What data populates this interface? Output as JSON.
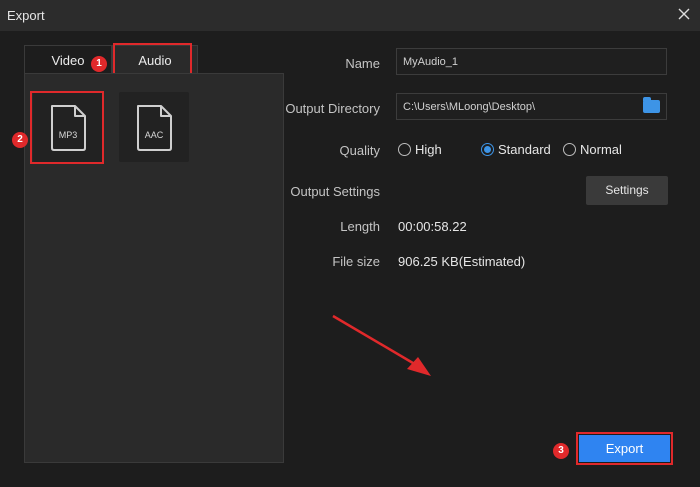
{
  "window": {
    "title": "Export"
  },
  "tabs": [
    {
      "label": "Video",
      "active": false
    },
    {
      "label": "Audio",
      "active": true
    }
  ],
  "formats": [
    {
      "label": "MP3",
      "selected": true
    },
    {
      "label": "AAC",
      "selected": false
    }
  ],
  "annotations": {
    "step1": "1",
    "step2": "2",
    "step3": "3"
  },
  "form": {
    "name_label": "Name",
    "name_value": "MyAudio_1",
    "output_dir_label": "Output Directory",
    "output_dir_value": "C:\\Users\\MLoong\\Desktop\\",
    "quality_label": "Quality",
    "quality_options": [
      {
        "label": "High",
        "selected": false
      },
      {
        "label": "Standard",
        "selected": true
      },
      {
        "label": "Normal",
        "selected": false
      }
    ],
    "output_settings_label": "Output Settings",
    "settings_button": "Settings",
    "length_label": "Length",
    "length_value": "00:00:58.22",
    "filesize_label": "File size",
    "filesize_value": "906.25 KB(Estimated)"
  },
  "export_button": "Export",
  "colors": {
    "accent": "#2f84f1",
    "highlight": "#e0292b",
    "background": "#1d1d1d"
  }
}
